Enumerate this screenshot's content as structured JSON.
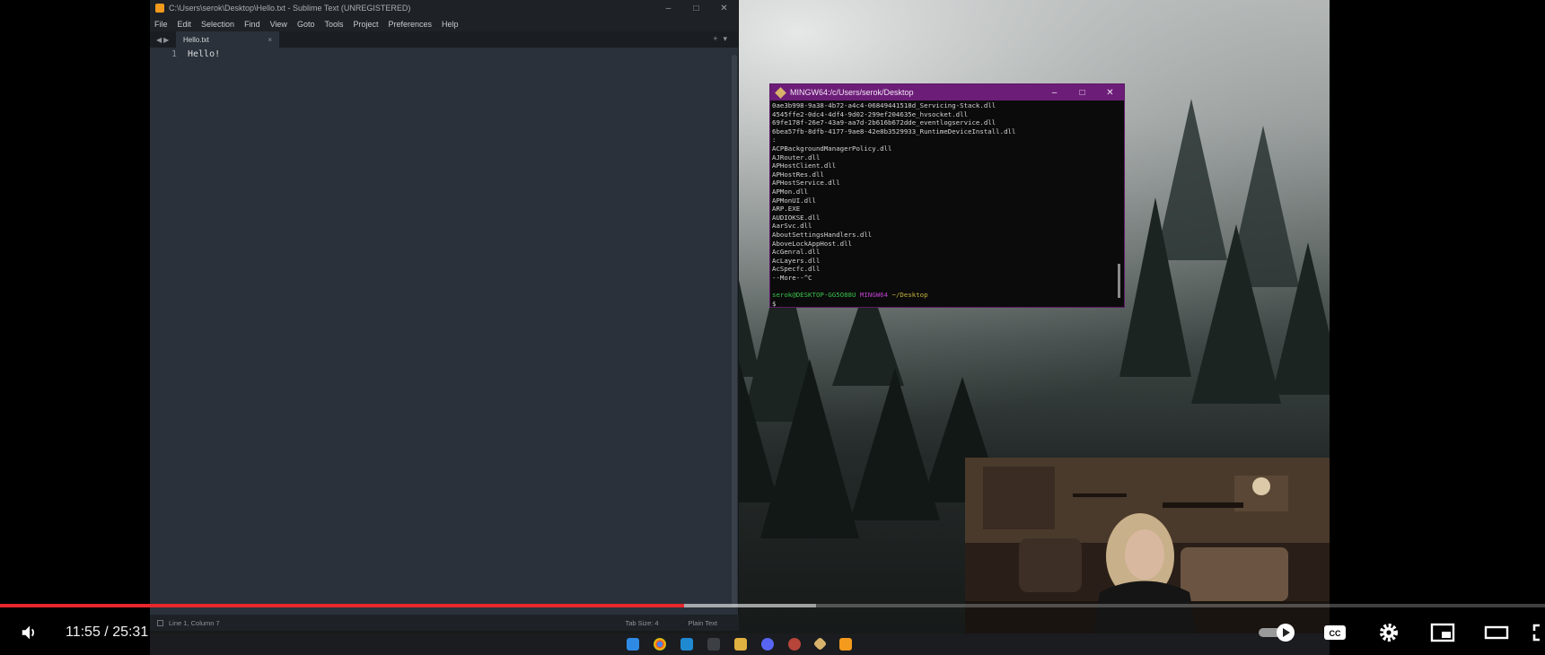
{
  "sublime": {
    "title": "C:\\Users\\serok\\Desktop\\Hello.txt - Sublime Text (UNREGISTERED)",
    "menu": [
      "File",
      "Edit",
      "Selection",
      "Find",
      "View",
      "Goto",
      "Tools",
      "Project",
      "Preferences",
      "Help"
    ],
    "tab_label": "Hello.txt",
    "line_number": "1",
    "line_text": "Hello!",
    "status_position": "Line 1, Column 7",
    "status_tab_size": "Tab Size: 4",
    "status_syntax": "Plain Text"
  },
  "terminal": {
    "title": "MINGW64:/c/Users/serok/Desktop",
    "lines": [
      "0ae3b998-9a38-4b72-a4c4-06849441518d_Servicing-Stack.dll",
      "4545ffe2-0dc4-4df4-9d02-299ef204635e_hvsocket.dll",
      "69fe178f-26e7-43a9-aa7d-2b616b672dde_eventlogservice.dll",
      "6bea57fb-8dfb-4177-9ae8-42e8b3529933_RuntimeDeviceInstall.dll",
      ":",
      "ACPBackgroundManagerPolicy.dll",
      "AJRouter.dll",
      "APHostClient.dll",
      "APHostRes.dll",
      "APHostService.dll",
      "APMon.dll",
      "APMonUI.dll",
      "ARP.EXE",
      "AUDIOKSE.dll",
      "AarSvc.dll",
      "AboutSettingsHandlers.dll",
      "AboveLockAppHost.dll",
      "AcGenral.dll",
      "AcLayers.dll",
      "AcSpecfc.dll",
      "--More--^C"
    ],
    "prompt_user": "serok@DESKTOP-GG5O88U",
    "prompt_host": "MINGW64",
    "prompt_dir": "~/Desktop",
    "prompt_symbol": "$"
  },
  "player": {
    "time_display": "11:55 / 25:31",
    "played_fraction": 0.443,
    "buffered_fraction": 0.528,
    "accent_color": "#e8272c"
  },
  "icons": [
    "volume-icon",
    "autoplay-toggle-icon",
    "captions-icon",
    "settings-icon",
    "miniplayer-icon",
    "theater-mode-icon",
    "fullscreen-icon"
  ]
}
